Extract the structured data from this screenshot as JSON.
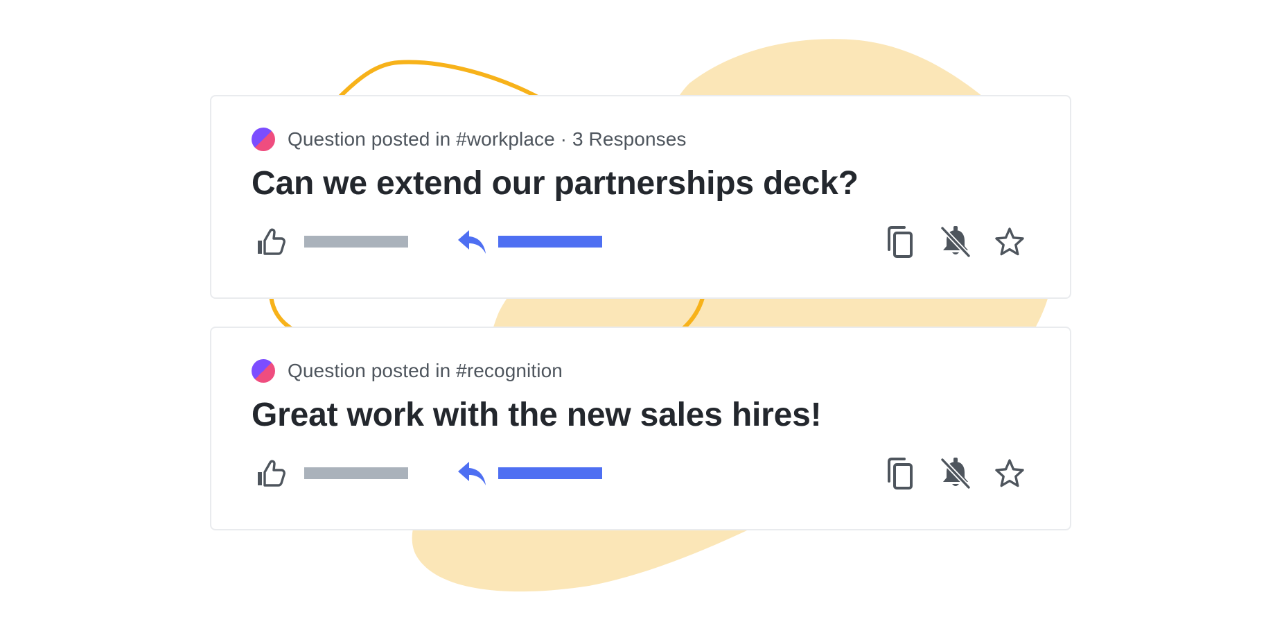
{
  "colors": {
    "blob_fill": "#fbe6b7",
    "ring_stroke": "#f7b21a",
    "avatar_purple": "#7c4dff",
    "avatar_pink": "#ef4d7f",
    "text_primary": "#23272d",
    "text_secondary": "#4e555d",
    "icon": "#4e555d",
    "reply_accent": "#4e6ff2",
    "placeholder_grey": "#aab2bb",
    "placeholder_blue": "#4e6ff2",
    "card_border": "#e9ebee"
  },
  "posts": [
    {
      "meta": "Question posted in #workplace · 3 Responses",
      "title": "Can we extend our partnerships deck?",
      "icons": [
        "thumbs-up-icon",
        "reply-icon",
        "copy-icon",
        "bell-off-icon",
        "star-icon"
      ]
    },
    {
      "meta": "Question posted in #recognition",
      "title": "Great work with the new sales hires!",
      "icons": [
        "thumbs-up-icon",
        "reply-icon",
        "copy-icon",
        "bell-off-icon",
        "star-icon"
      ]
    }
  ]
}
